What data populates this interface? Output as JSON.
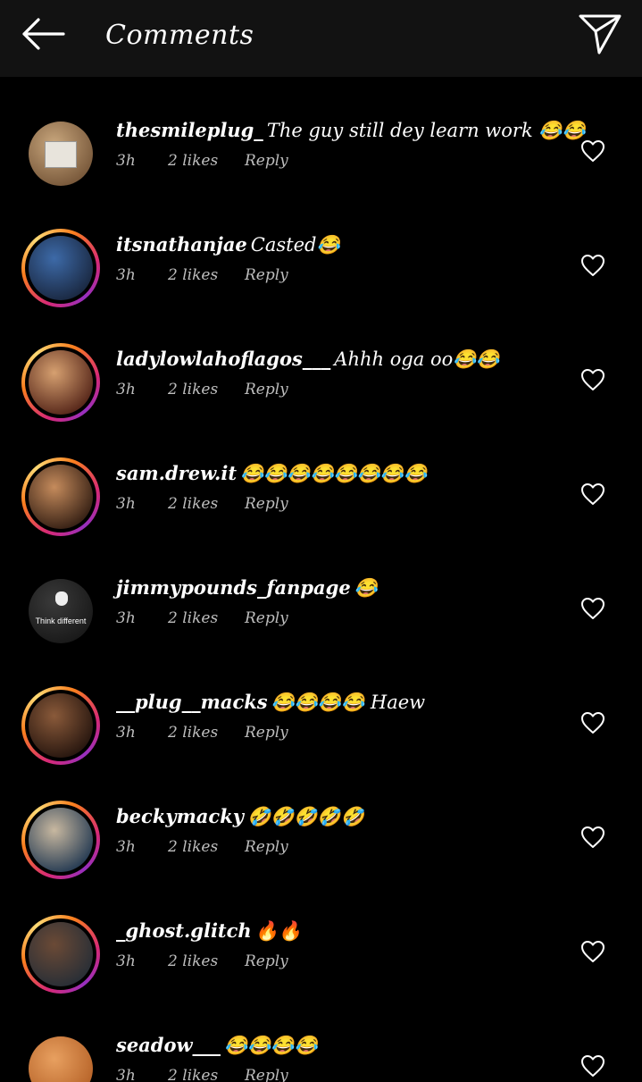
{
  "header": {
    "title": "Comments",
    "back_icon": "arrow-left-icon",
    "share_icon": "paper-plane-icon"
  },
  "comments": [
    {
      "username": "thesmileplug_",
      "text": "The guy still dey learn work 😂😂",
      "time": "3h",
      "likes": "2 likes",
      "reply": "Reply",
      "story_ring": false,
      "avatar_colors": [
        "#7a5a3c",
        "#c9a77d"
      ]
    },
    {
      "username": "itsnathanjae",
      "text": "Casted😂",
      "time": "3h",
      "likes": "2 likes",
      "reply": "Reply",
      "story_ring": true,
      "avatar_colors": [
        "#1b2a44",
        "#3d6aa8"
      ]
    },
    {
      "username": "ladylowlahoflagos___",
      "text": "Ahhh oga oo😂😂",
      "time": "3h",
      "likes": "2 likes",
      "reply": "Reply",
      "story_ring": true,
      "avatar_colors": [
        "#5a2a1c",
        "#d6a070"
      ]
    },
    {
      "username": "sam.drew.it",
      "text": "😂😂😂😂😂😂😂😂",
      "time": "3h",
      "likes": "2 likes",
      "reply": "Reply",
      "story_ring": true,
      "avatar_colors": [
        "#3a2316",
        "#c58b5c"
      ]
    },
    {
      "username": "jimmypounds_fanpage",
      "text": "😂",
      "time": "3h",
      "likes": "2 likes",
      "reply": "Reply",
      "story_ring": false,
      "avatar_colors": [
        "#1a1a1a",
        "#3a3a3a"
      ]
    },
    {
      "username": "__plug__macks",
      "text": "😂😂😂😂 Haew",
      "time": "3h",
      "likes": "2 likes",
      "reply": "Reply",
      "story_ring": true,
      "avatar_colors": [
        "#2a1810",
        "#8a5a3a"
      ]
    },
    {
      "username": "beckymacky",
      "text": "🤣🤣🤣🤣🤣",
      "time": "3h",
      "likes": "2 likes",
      "reply": "Reply",
      "story_ring": true,
      "avatar_colors": [
        "#2b3f55",
        "#c8b8a0"
      ]
    },
    {
      "username": "_ghost.glitch",
      "text": "🔥🔥",
      "time": "3h",
      "likes": "2 likes",
      "reply": "Reply",
      "story_ring": true,
      "avatar_colors": [
        "#2a2f36",
        "#6b4a36"
      ]
    },
    {
      "username": "seadow___",
      "text": "😂😂😂😂",
      "time": "3h",
      "likes": "2 likes",
      "reply": "Reply",
      "story_ring": false,
      "avatar_colors": [
        "#b8652a",
        "#e8a060"
      ]
    }
  ],
  "like_icon": "heart-outline-icon",
  "special_avatar_text": {
    "index": 4,
    "text": "Think different"
  }
}
